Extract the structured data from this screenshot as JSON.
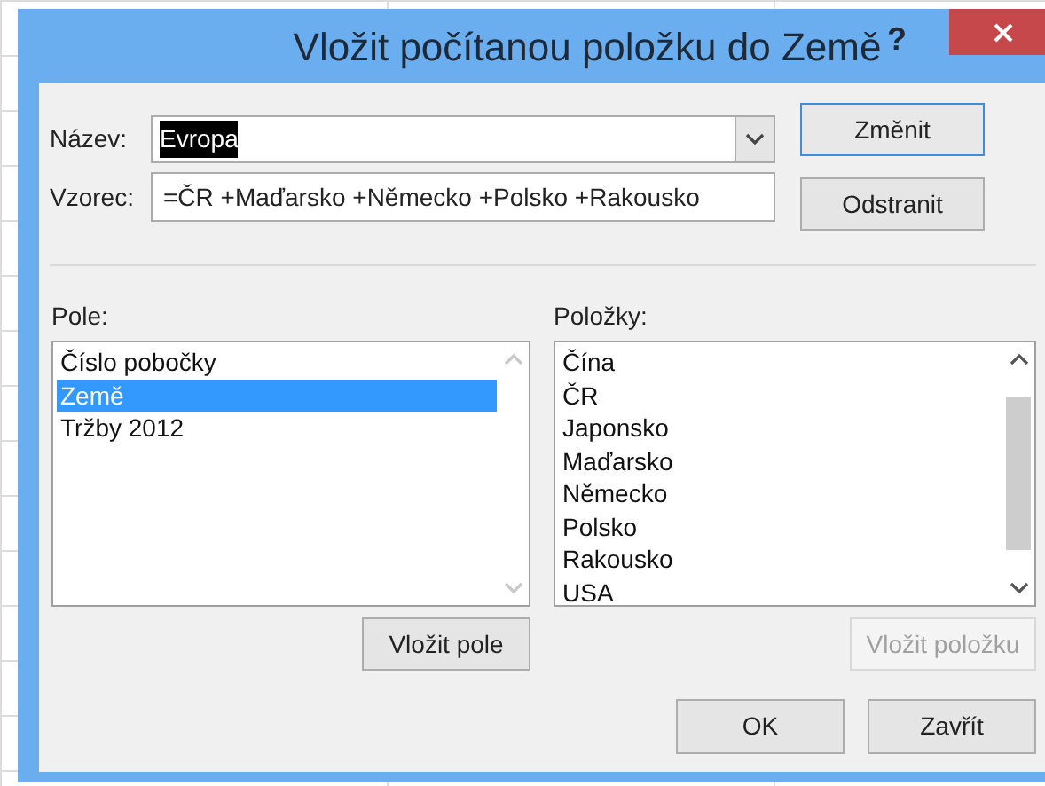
{
  "window": {
    "title": "Vložit počítanou položku do Země",
    "help": "?"
  },
  "name_field": {
    "label": "Název:",
    "value": "Evropa",
    "highlighted": true
  },
  "formula_field": {
    "label": "Vzorec:",
    "value": "=ČR +Maďarsko +Německo +Polsko +Rakousko"
  },
  "side_buttons": [
    {
      "label": "Změnit",
      "disabled": false,
      "default": true
    },
    {
      "label": "Odstranit",
      "disabled": false,
      "default": false
    }
  ],
  "fields": {
    "label": "Pole:",
    "items": [
      {
        "label": "Číslo pobočky",
        "selected": false
      },
      {
        "label": "Země",
        "selected": true
      },
      {
        "label": "Tržby 2012",
        "selected": false
      }
    ],
    "button": {
      "label": "Vložit pole",
      "disabled": false
    }
  },
  "items": {
    "label": "Položky:",
    "items": [
      {
        "label": "Čína",
        "selected": false
      },
      {
        "label": "ČR",
        "selected": false
      },
      {
        "label": "Japonsko",
        "selected": false
      },
      {
        "label": "Maďarsko",
        "selected": false
      },
      {
        "label": "Německo",
        "selected": false
      },
      {
        "label": "Polsko",
        "selected": false
      },
      {
        "label": "Rakousko",
        "selected": false
      },
      {
        "label": "USA",
        "selected": false
      }
    ],
    "button": {
      "label": "Vložit položku",
      "disabled": true
    }
  },
  "buttons": [
    {
      "label": "OK",
      "disabled": false
    },
    {
      "label": "Zavřít",
      "disabled": false
    }
  ]
}
